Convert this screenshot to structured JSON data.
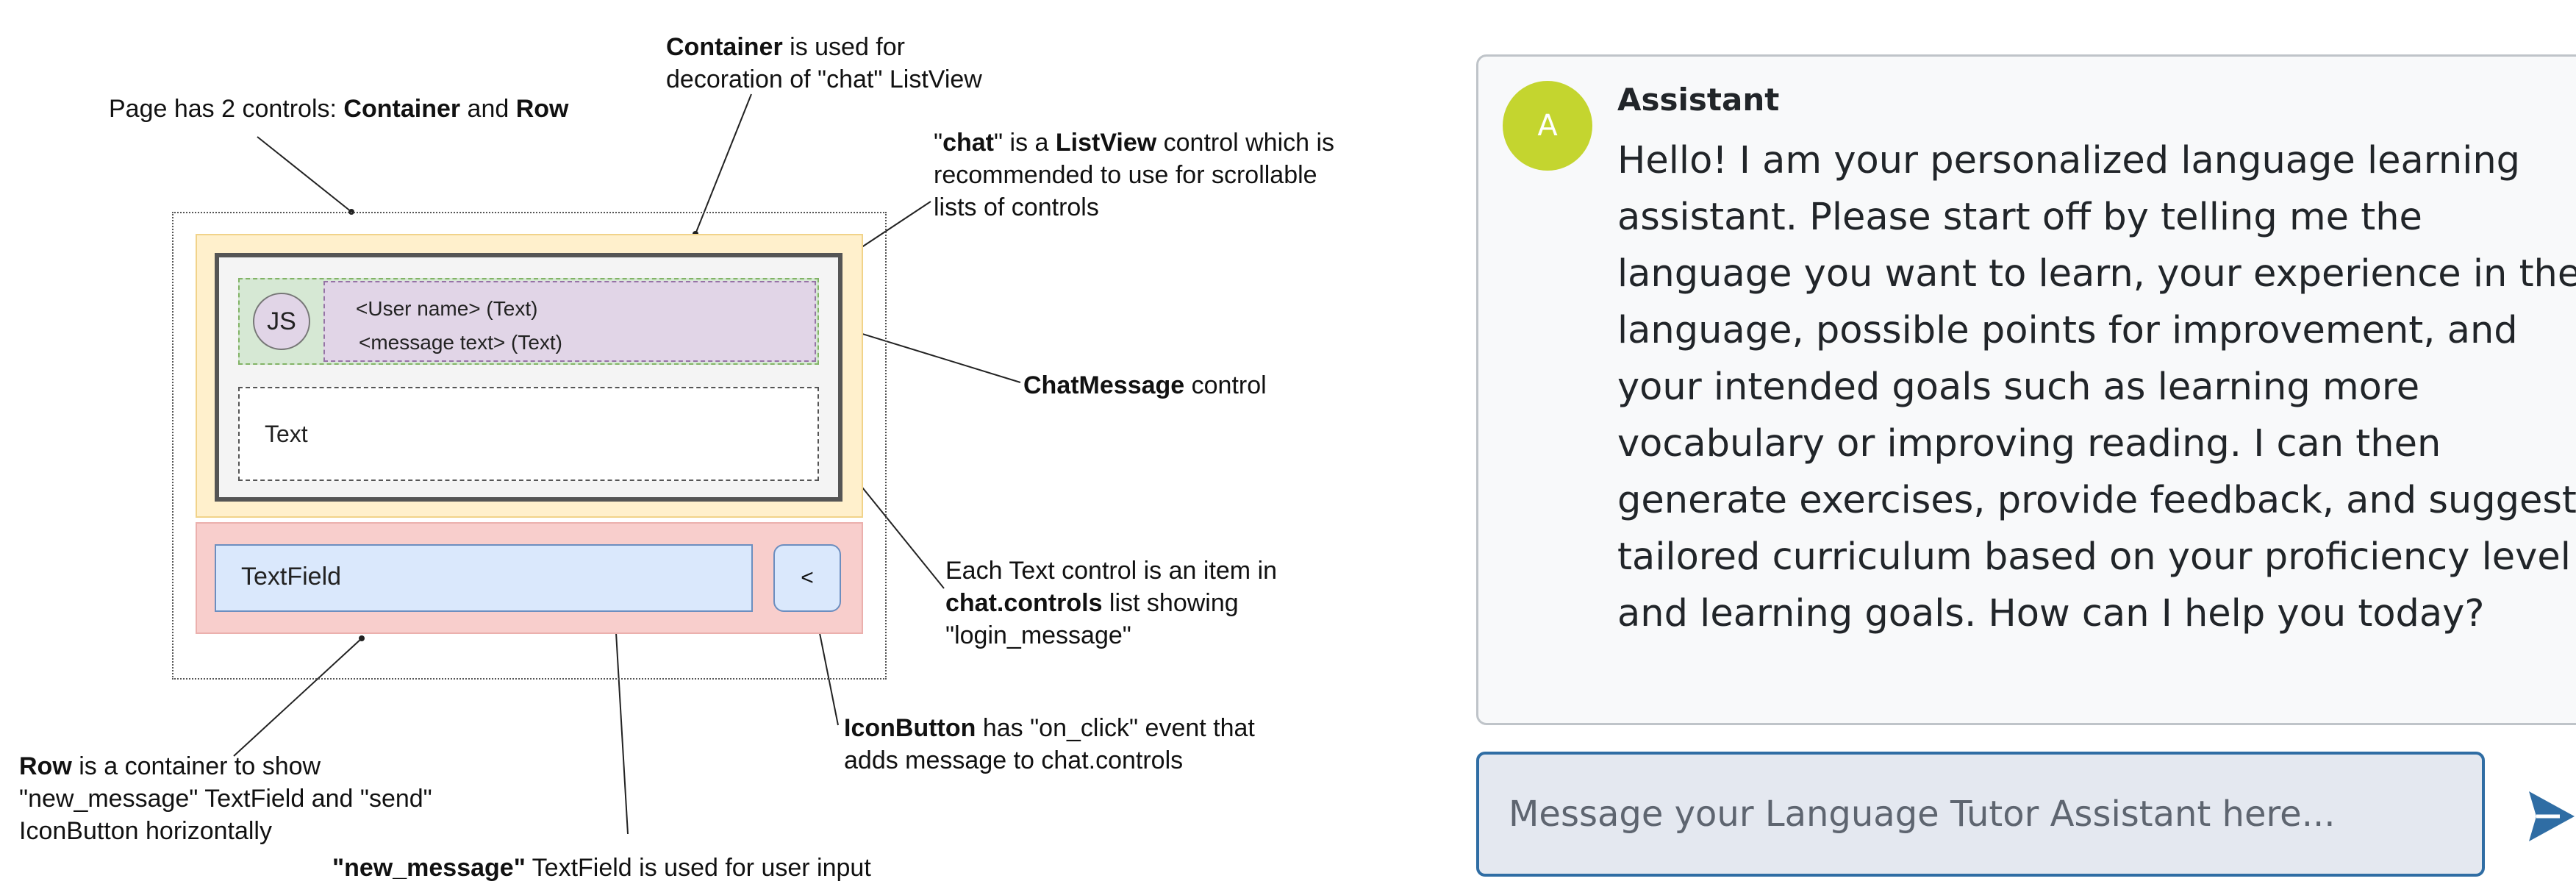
{
  "diagram": {
    "annotations": {
      "page": {
        "pre": "Page has 2 controls: ",
        "b1": "Container",
        "mid": " and ",
        "b2": "Row"
      },
      "container": {
        "b": "Container",
        "rest": " is used for",
        "line2": "decoration of \"chat\" ListView"
      },
      "chat": {
        "q1": "\"",
        "b1": "chat",
        "mid": "\" is a ",
        "b2": "ListView",
        "rest": " control which is",
        "line2": "recommended to use for scrollable",
        "line3": "lists of controls"
      },
      "chatmessage": {
        "b": "ChatMessage",
        "rest": " control"
      },
      "text_item": {
        "line1": "Each Text control is an item in",
        "b": "chat.controls",
        "rest": " list showing",
        "line3": "\"login_message\""
      },
      "iconbutton": {
        "b": "IconButton",
        "rest": " has \"on_click\" event that",
        "line2": "adds message to chat.controls"
      },
      "row": {
        "b": "Row",
        "rest": " is a container to show",
        "line2": "\"new_message\" TextField and \"send\"",
        "line3": "IconButton horizontally"
      },
      "new_message": {
        "b": "\"new_message\"",
        "rest": " TextField is used for user input"
      }
    },
    "mock": {
      "avatar_initials": "JS",
      "user_name": "<User name> (Text)",
      "message_text": "<message text> (Text)",
      "text_label": "Text",
      "textfield_label": "TextField",
      "icon_button_label": "<"
    }
  },
  "chat_ui": {
    "avatar_letter": "A",
    "sender_name": "Assistant",
    "message": "Hello! I am your personalized language learning assistant. Please start off by telling me the language you want to learn, your experience in the language, possible points for improvement, and your intended goals such as learning more vocabulary or improving reading. I can then generate exercises, provide feedback, and suggest tailored curriculum based on your proficiency level and learning goals. How can I help you today?",
    "input_placeholder": "Message your Language Tutor Assistant here...",
    "send_icon": "send-icon",
    "accent_color": "#2f6da4",
    "avatar_color": "#c4d52f"
  }
}
